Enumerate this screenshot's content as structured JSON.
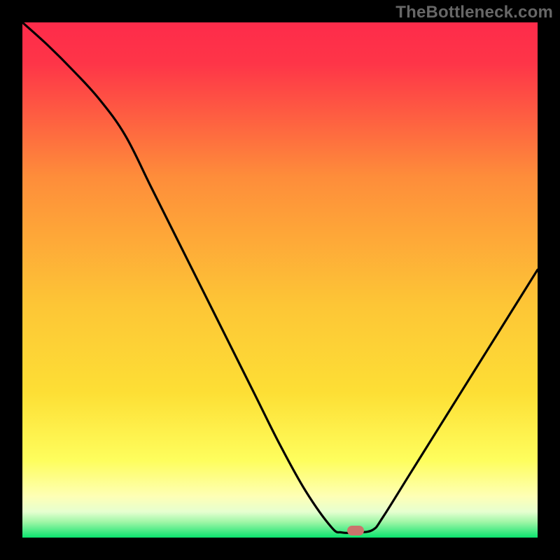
{
  "watermark": {
    "text": "TheBottleneck.com"
  },
  "colors": {
    "frame": "#000000",
    "gradient_top": "#fe2b4a",
    "gradient_mid_upper": "#fe8d3a",
    "gradient_mid": "#fddf35",
    "gradient_low": "#feff9f",
    "gradient_bottom": "#0ae36e",
    "curve": "#000000",
    "marker": "#cb746c",
    "watermark": "#676767"
  },
  "marker": {
    "x_frac": 0.647,
    "y_frac": 0.986
  },
  "chart_data": {
    "type": "line",
    "title": "",
    "xlabel": "",
    "ylabel": "",
    "xlim": [
      0,
      1
    ],
    "ylim": [
      0,
      100
    ],
    "series": [
      {
        "name": "bottleneck-curve",
        "x": [
          0.0,
          0.05,
          0.1,
          0.15,
          0.2,
          0.25,
          0.3,
          0.35,
          0.4,
          0.45,
          0.5,
          0.55,
          0.6,
          0.62,
          0.65,
          0.68,
          0.7,
          0.75,
          0.8,
          0.85,
          0.9,
          0.95,
          1.0
        ],
        "y": [
          100,
          95.5,
          90.5,
          85.0,
          78.0,
          68.0,
          58.0,
          48.0,
          38.0,
          28.0,
          18.0,
          9.0,
          2.0,
          1.0,
          1.0,
          1.5,
          4.0,
          12.0,
          20.0,
          28.0,
          36.0,
          44.0,
          52.0
        ]
      }
    ],
    "annotations": [
      {
        "type": "marker",
        "x": 0.647,
        "y": 1.0,
        "label": "optimal-point"
      }
    ]
  }
}
